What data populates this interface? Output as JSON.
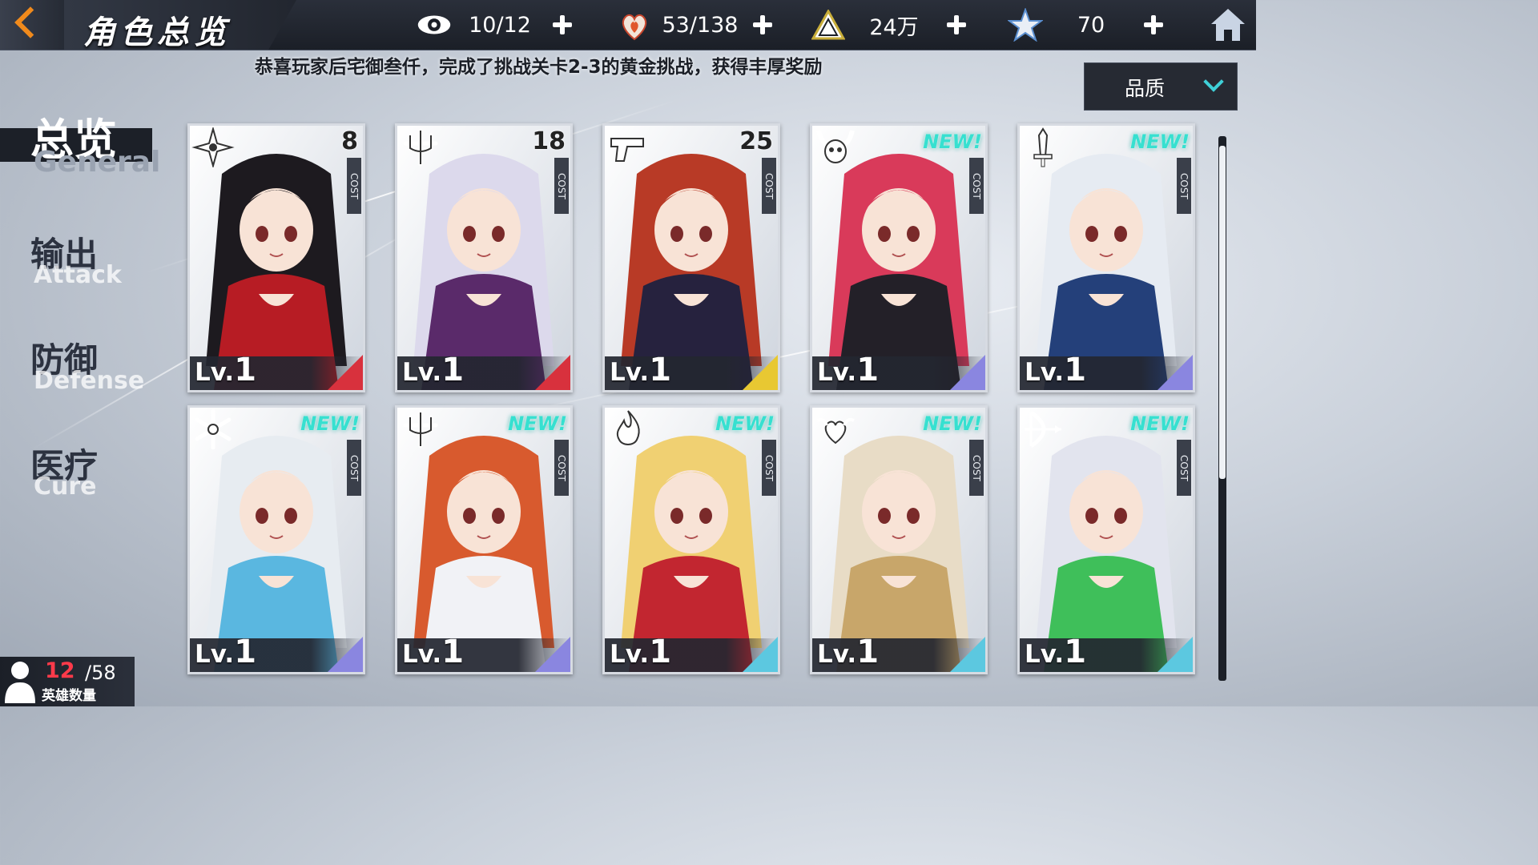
{
  "header": {
    "title": "角色总览",
    "back_icon": "back-arrow-icon",
    "home_icon": "home-icon",
    "resources": [
      {
        "icon": "eye-icon",
        "value": "10/12"
      },
      {
        "icon": "heart-flame-icon",
        "value": "53/138"
      },
      {
        "icon": "triangle-gem-icon",
        "value": "24万"
      },
      {
        "icon": "star-badge-icon",
        "value": "70"
      }
    ]
  },
  "ticker": "恭喜玩家后宅御叁仟，完成了挑战关卡2-3的黄金挑战，获得丰厚奖励",
  "sort": {
    "label": "品质",
    "icon": "chevron-down-icon"
  },
  "sidebar": [
    {
      "zh": "总览",
      "en": "General",
      "active": true
    },
    {
      "zh": "输出",
      "en": "Attack",
      "active": false
    },
    {
      "zh": "防御",
      "en": "Defense",
      "active": false
    },
    {
      "zh": "医疗",
      "en": "Cure",
      "active": false
    }
  ],
  "cards": [
    {
      "class_icon": "shuriken-icon",
      "cost": "8",
      "cost_label": "COST",
      "new": "",
      "lv_prefix": "Lv.",
      "lv": "1",
      "rarity_color": "#d8313d",
      "hair": "#1d1a1f",
      "outfit": "#b71c24"
    },
    {
      "class_icon": "trident-crest-icon",
      "cost": "18",
      "cost_label": "COST",
      "new": "",
      "lv_prefix": "Lv.",
      "lv": "1",
      "rarity_color": "#d8313d",
      "hair": "#dcd9ec",
      "outfit": "#5a2a6a"
    },
    {
      "class_icon": "pistol-icon",
      "cost": "25",
      "cost_label": "COST",
      "new": "",
      "lv_prefix": "Lv.",
      "lv": "1",
      "rarity_color": "#e8c832",
      "hair": "#b83a26",
      "outfit": "#26223e"
    },
    {
      "class_icon": "horned-skull-icon",
      "cost": "",
      "cost_label": "COST",
      "new": "NEW!",
      "lv_prefix": "Lv.",
      "lv": "1",
      "rarity_color": "#8a86e0",
      "hair": "#d93a5a",
      "outfit": "#232028"
    },
    {
      "class_icon": "sword-icon",
      "cost": "",
      "cost_label": "COST",
      "new": "NEW!",
      "lv_prefix": "Lv.",
      "lv": "1",
      "rarity_color": "#8a86e0",
      "hair": "#e6ebf2",
      "outfit": "#24407a"
    },
    {
      "class_icon": "snowflake-icon",
      "cost": "",
      "cost_label": "COST",
      "new": "NEW!",
      "lv_prefix": "Lv.",
      "lv": "1",
      "rarity_color": "#8a86e0",
      "hair": "#e7ecf1",
      "outfit": "#5ab7e0"
    },
    {
      "class_icon": "trident-crest-icon",
      "cost": "",
      "cost_label": "COST",
      "new": "NEW!",
      "lv_prefix": "Lv.",
      "lv": "1",
      "rarity_color": "#8a86e0",
      "hair": "#d85a2e",
      "outfit": "#f1f2f6"
    },
    {
      "class_icon": "flame-icon",
      "cost": "",
      "cost_label": "COST",
      "new": "NEW!",
      "lv_prefix": "Lv.",
      "lv": "1",
      "rarity_color": "#5cc8e0",
      "hair": "#f0d072",
      "outfit": "#c22630"
    },
    {
      "class_icon": "winged-heart-icon",
      "cost": "",
      "cost_label": "COST",
      "new": "NEW!",
      "lv_prefix": "Lv.",
      "lv": "1",
      "rarity_color": "#5cc8e0",
      "hair": "#e8dcc6",
      "outfit": "#c8a66a"
    },
    {
      "class_icon": "bow-icon",
      "cost": "",
      "cost_label": "COST",
      "new": "NEW!",
      "lv_prefix": "Lv.",
      "lv": "1",
      "rarity_color": "#5cc8e0",
      "hair": "#e2e4ee",
      "outfit": "#3fbf5a"
    }
  ],
  "hero_count": {
    "current": "12",
    "total": "/58",
    "label": "英雄数量",
    "icon": "person-icon"
  }
}
